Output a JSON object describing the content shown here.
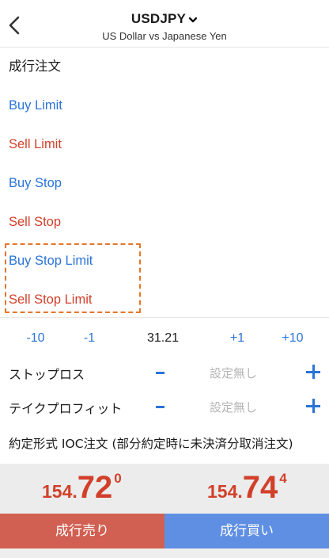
{
  "header": {
    "symbol": "USDJPY",
    "description": "US Dollar vs Japanese Yen"
  },
  "order_types": [
    {
      "label": "成行注文",
      "kind": "market"
    },
    {
      "label": "Buy Limit",
      "kind": "buy"
    },
    {
      "label": "Sell Limit",
      "kind": "sell"
    },
    {
      "label": "Buy Stop",
      "kind": "buy"
    },
    {
      "label": "Sell Stop",
      "kind": "sell"
    },
    {
      "label": "Buy Stop Limit",
      "kind": "buy"
    },
    {
      "label": "Sell Stop Limit",
      "kind": "sell"
    }
  ],
  "volume": {
    "minus10": "-10",
    "minus1": "-1",
    "value": "31.21",
    "plus1": "+1",
    "plus10": "+10"
  },
  "stop_loss": {
    "label": "ストップロス",
    "value": "設定無し"
  },
  "take_profit": {
    "label": "テイクプロフィット",
    "value": "設定無し"
  },
  "execution_type": "約定形式 IOC注文 (部分約定時に未決済分取消注文)",
  "prices": {
    "bid": {
      "prefix": "154.",
      "big": "72",
      "pip": "0"
    },
    "ask": {
      "prefix": "154.",
      "big": "74",
      "pip": "4"
    }
  },
  "actions": {
    "sell_label": "成行売り",
    "buy_label": "成行買い"
  },
  "colors": {
    "buy": "#2a74d9",
    "sell": "#d1402a",
    "highlight": "#e3772a"
  }
}
